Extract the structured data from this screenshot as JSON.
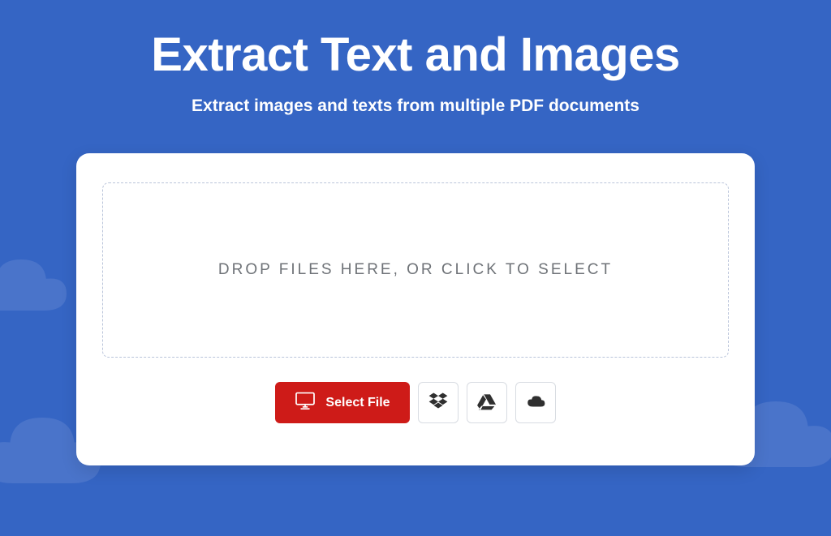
{
  "header": {
    "title": "Extract Text and Images",
    "subtitle": "Extract images and texts from multiple PDF documents"
  },
  "dropzone": {
    "placeholder": "DROP FILES HERE, OR CLICK TO SELECT"
  },
  "buttons": {
    "select_file": "Select File"
  },
  "providers": {
    "dropbox": "dropbox",
    "google_drive": "google-drive",
    "onedrive": "onedrive"
  },
  "colors": {
    "background": "#3565c4",
    "card": "#ffffff",
    "primary_button": "#ce1b18",
    "cloud": "#4a74ca"
  }
}
